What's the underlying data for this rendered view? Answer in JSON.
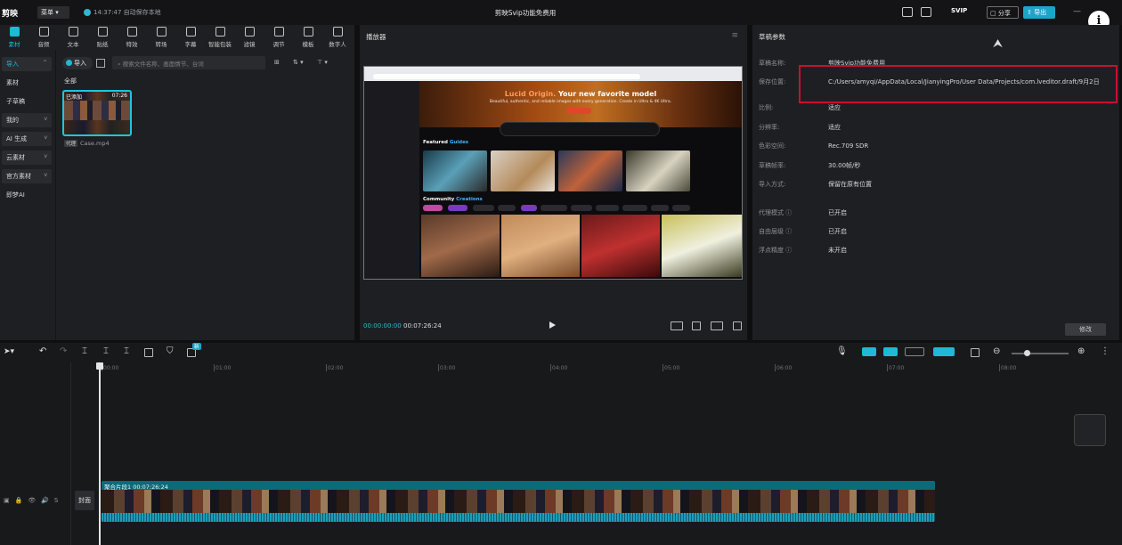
{
  "topbar": {
    "logo": "剪映",
    "menu_label": "菜单",
    "save_status": "14:37:47 自动保存本地",
    "project_title": "剪映Svip功能免费用",
    "svip": "SVIP",
    "share": "分享",
    "export": "导出"
  },
  "tools": [
    {
      "label": "素材",
      "icon": "media-icon"
    },
    {
      "label": "音频",
      "icon": "audio-icon"
    },
    {
      "label": "文本",
      "icon": "text-icon"
    },
    {
      "label": "贴纸",
      "icon": "sticker-icon"
    },
    {
      "label": "特效",
      "icon": "effects-icon"
    },
    {
      "label": "转场",
      "icon": "transition-icon"
    },
    {
      "label": "字幕",
      "icon": "subtitle-icon"
    },
    {
      "label": "智能包装",
      "icon": "smart-pack-icon"
    },
    {
      "label": "滤镜",
      "icon": "filter-icon"
    },
    {
      "label": "调节",
      "icon": "adjust-icon"
    },
    {
      "label": "模板",
      "icon": "template-icon"
    },
    {
      "label": "数字人",
      "icon": "avatar-icon"
    }
  ],
  "sidebar": [
    {
      "label": "导入",
      "selected": true,
      "caret": "^"
    },
    {
      "label": "素材"
    },
    {
      "label": "子草稿"
    },
    {
      "label": "我的",
      "caret": "v"
    },
    {
      "label": "AI 生成",
      "caret": "v"
    },
    {
      "label": "云素材",
      "caret": "v"
    },
    {
      "label": "官方素材",
      "caret": "v"
    },
    {
      "label": "即梦AI"
    }
  ],
  "media_panel": {
    "import_btn": "导入",
    "search_placeholder": "搜索文件名称、画面情节、台词",
    "section_all": "全部",
    "clip_added": "已添加",
    "clip_duration": "07:26",
    "clip_tag": "代理",
    "clip_name": "Case.mp4"
  },
  "player": {
    "title": "播放器",
    "current_time": "00:00:00:00",
    "total_time": "00:07:26:24",
    "preview": {
      "hero_title_accent": "Lucid Origin.",
      "hero_title": " Your new favorite model",
      "hero_sub": "Beautiful, authentic, and reliable images with every generation. Create in Ultra & 4K Ultra.",
      "featured_label": "Featured",
      "featured_accent": "Guides",
      "community_label": "Community",
      "community_accent": "Creations"
    }
  },
  "props": {
    "title": "草稿参数",
    "rows": [
      {
        "k": "草稿名称:",
        "v": "剪映Svip功能免费用"
      },
      {
        "k": "保存位置:",
        "v": "C:/Users/amyqi/AppData/Local/JianyingPro/User Data/Projects/com.lveditor.draft/9月2日"
      },
      {
        "k": "比例:",
        "v": "适应"
      },
      {
        "k": "分辨率:",
        "v": "适应"
      },
      {
        "k": "色彩空间:",
        "v": "Rec.709 SDR"
      },
      {
        "k": "草稿帧率:",
        "v": "30.00帧/秒"
      },
      {
        "k": "导入方式:",
        "v": "保留在原有位置"
      },
      {
        "k": "代理模式 ⓘ",
        "v": "已开启"
      },
      {
        "k": "自由层级 ⓘ",
        "v": "已开启"
      },
      {
        "k": "浮点精度 ⓘ",
        "v": "未开启"
      }
    ],
    "edit_btn": "修改"
  },
  "timeline": {
    "ticks": [
      "00:00",
      "01:00",
      "02:00",
      "03:00",
      "04:00",
      "05:00",
      "06:00",
      "07:00",
      "08:00"
    ],
    "cover_label": "封面",
    "clip_title": "聚合片段1  00:07:26:24",
    "new_badge": "新"
  },
  "colors": {
    "accent": "#1fb8d6",
    "highlight_box": "#c8102e"
  }
}
